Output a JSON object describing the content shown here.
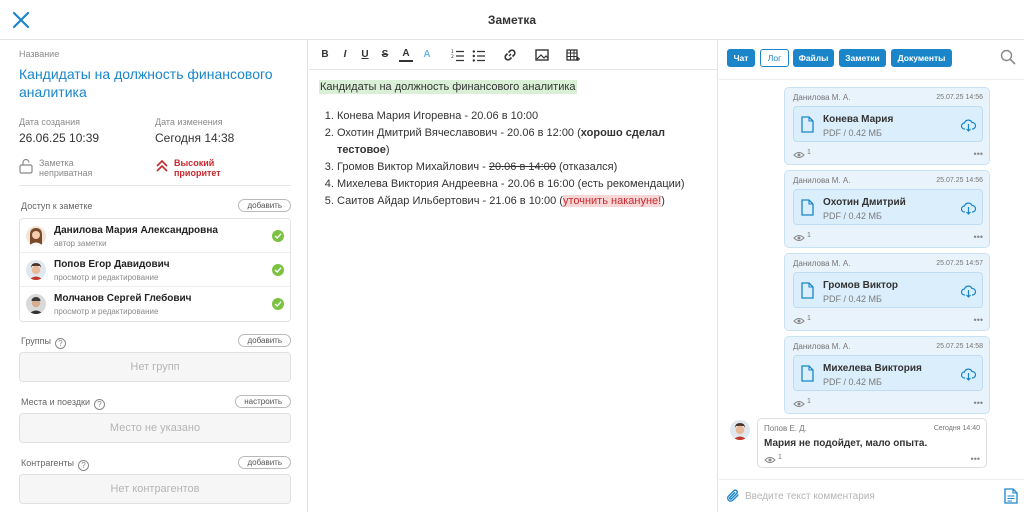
{
  "window": {
    "title": "Заметка"
  },
  "note": {
    "name_label": "Название",
    "title": "Кандидаты на должность финансового аналитика",
    "created_label": "Дата создания",
    "created_value": "26.06.25 10:39",
    "modified_label": "Дата изменения",
    "modified_value": "Сегодня 14:38",
    "privacy_line1": "Заметка",
    "privacy_line2": "неприватная",
    "priority_line1": "Высокий",
    "priority_line2": "приоритет"
  },
  "access": {
    "title": "Доступ к заметке",
    "add_label": "добавить",
    "people": [
      {
        "name": "Данилова Мария Александровна",
        "role": "автор заметки"
      },
      {
        "name": "Попов Егор Давидович",
        "role": "просмотр и редактирование"
      },
      {
        "name": "Молчанов Сергей Глебович",
        "role": "просмотр и редактирование"
      }
    ]
  },
  "groups": {
    "title": "Группы",
    "add_label": "добавить",
    "empty": "Нет групп"
  },
  "places": {
    "title": "Места и поездки",
    "configure_label": "настроить",
    "empty": "Место не указано"
  },
  "contractors": {
    "title": "Контрагенты",
    "add_label": "добавить",
    "empty": "Нет контрагентов"
  },
  "toolbar": {
    "bold": "B",
    "italic": "I",
    "underline": "U",
    "strike": "S",
    "text_color": "A",
    "highlight": "A"
  },
  "editor": {
    "heading": "Кандидаты на должность финансового аналитика",
    "items": [
      {
        "pre": "Конева Мария Игоревна - 20.06 в 10:00",
        "bold": "",
        "strike": "",
        "post": ""
      },
      {
        "pre": "Охотин Дмитрий Вячеславович - 20.06 в 12:00 (",
        "bold": "хорошо сделал тестовое",
        "strike": "",
        "post": ")"
      },
      {
        "pre": "Громов Виктор Михайлович - ",
        "bold": "",
        "strike": "20.06 в 14:00",
        "post": " (отказался)"
      },
      {
        "pre": "Михелева Виктория Андреевна - 20.06 в 16:00 (есть рекомендации)",
        "bold": "",
        "strike": "",
        "post": ""
      },
      {
        "pre": "Саитов Айдар Ильбертович - 21.06 в 10:00 (",
        "highlight": "уточнить накануне!",
        "post": ")"
      }
    ]
  },
  "chat": {
    "tabs": [
      "Чат",
      "Лог",
      "Файлы",
      "Заметки",
      "Документы"
    ],
    "messages": [
      {
        "author": "Данилова М. А.",
        "time": "25.07.25 14:56",
        "file_name": "Конева Мария",
        "file_size": "PDF / 0.42 МБ",
        "views": "1"
      },
      {
        "author": "Данилова М. А.",
        "time": "25.07.25 14:56",
        "file_name": "Охотин Дмитрий",
        "file_size": "PDF / 0.42 МБ",
        "views": "1"
      },
      {
        "author": "Данилова М. А.",
        "time": "25.07.25 14:57",
        "file_name": "Громов Виктор",
        "file_size": "PDF / 0.42 МБ",
        "views": "1"
      },
      {
        "author": "Данилова М. А.",
        "time": "25.07.25 14:58",
        "file_name": "Михелева Виктория",
        "file_size": "PDF / 0.42 МБ",
        "views": "1"
      }
    ],
    "comment": {
      "author": "Попов Е. Д.",
      "time": "Сегодня 14:40",
      "text": "Мария не подойдет, мало опыта.",
      "views": "1"
    },
    "input_placeholder": "Введите текст комментария"
  },
  "colors": {
    "accent": "#1a86c9",
    "priority": "#c8282d",
    "success": "#7cc242",
    "highlight_green": "#d9efd6"
  }
}
